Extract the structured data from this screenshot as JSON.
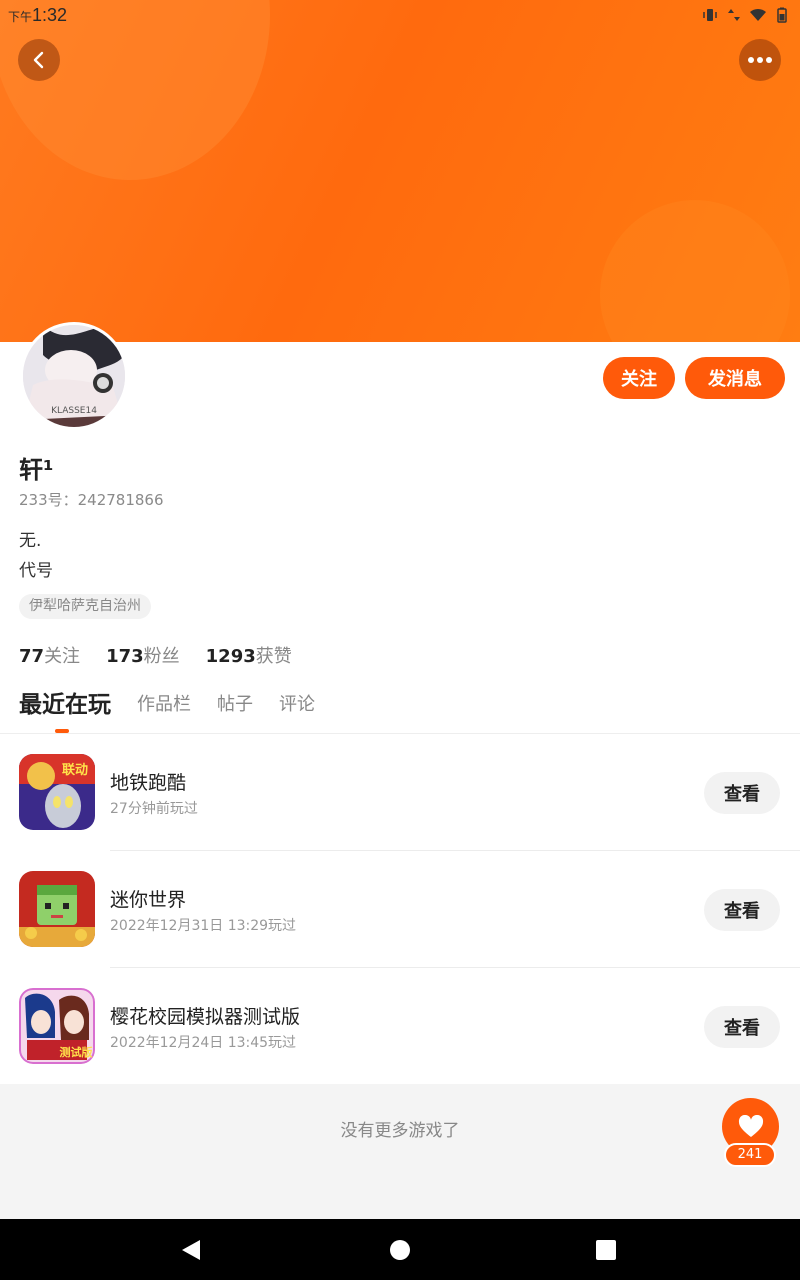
{
  "status_bar": {
    "time_prefix": "下午",
    "time": "1:32"
  },
  "profile": {
    "name": "轩¹",
    "uid_label": "233号：242781866",
    "bio_lines": [
      "无.",
      "代号"
    ],
    "location_tag": "伊犁哈萨克自治州",
    "avatar_watermark": "KLASSE14"
  },
  "actions": {
    "follow_label": "关注",
    "message_label": "发消息"
  },
  "stats": [
    {
      "count": "77",
      "label": "关注"
    },
    {
      "count": "173",
      "label": "粉丝"
    },
    {
      "count": "1293",
      "label": "获赞"
    }
  ],
  "tabs": [
    {
      "label": "最近在玩",
      "active": true
    },
    {
      "label": "作品栏",
      "active": false
    },
    {
      "label": "帖子",
      "active": false
    },
    {
      "label": "评论",
      "active": false
    }
  ],
  "games": [
    {
      "name": "地铁跑酷",
      "time": "27分钟前玩过",
      "button": "查看",
      "icon_badge": "联动"
    },
    {
      "name": "迷你世界",
      "time": "2022年12月31日 13:29玩过",
      "button": "查看"
    },
    {
      "name": "樱花校园模拟器测试版",
      "time": "2022年12月24日 13:45玩过",
      "button": "查看",
      "icon_badge": "测试版"
    }
  ],
  "footer": {
    "no_more_text": "没有更多游戏了"
  },
  "like": {
    "count": "241"
  },
  "colors": {
    "accent": "#ff5a0a",
    "banner": "#ff7a1f"
  }
}
